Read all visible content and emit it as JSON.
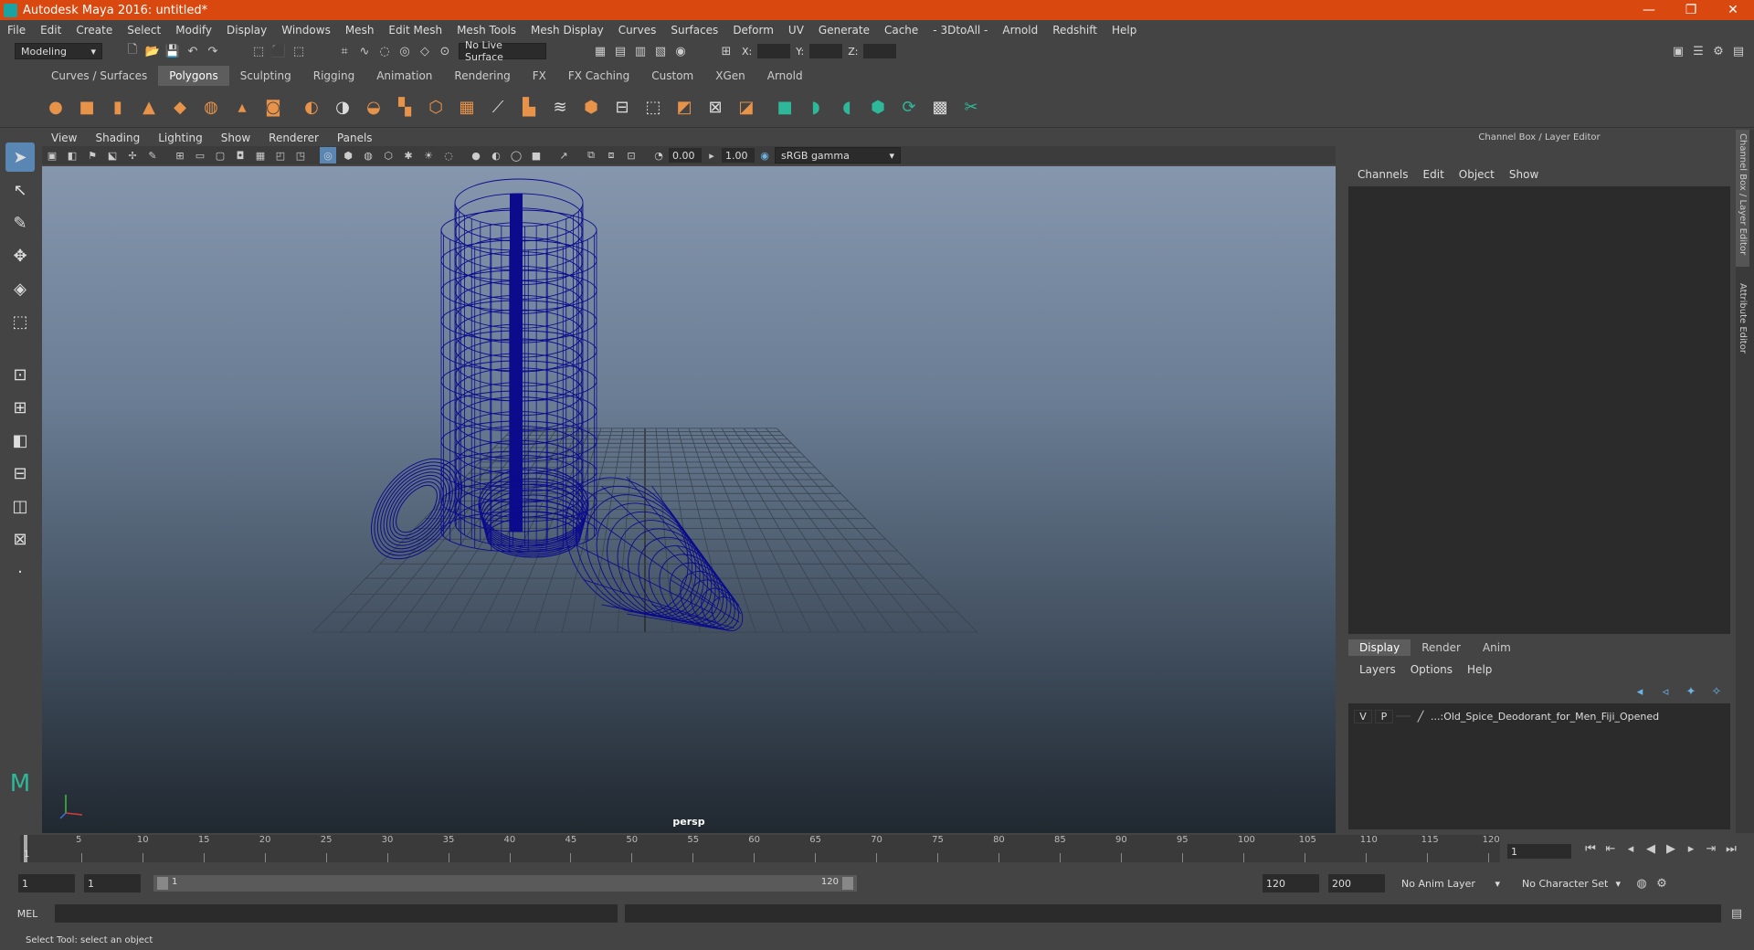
{
  "window": {
    "title": "Autodesk Maya 2016: untitled*",
    "min": "—",
    "max": "❐",
    "close": "✕"
  },
  "menubar": [
    "File",
    "Edit",
    "Create",
    "Select",
    "Modify",
    "Display",
    "Windows",
    "Mesh",
    "Edit Mesh",
    "Mesh Tools",
    "Mesh Display",
    "Curves",
    "Surfaces",
    "Deform",
    "UV",
    "Generate",
    "Cache",
    "- 3DtoAll -",
    "Arnold",
    "Redshift",
    "Help"
  ],
  "status": {
    "mode": "Modeling",
    "live_surface": "No Live Surface",
    "x_label": "X:",
    "y_label": "Y:",
    "z_label": "Z:"
  },
  "shelf_tabs": [
    "Curves / Surfaces",
    "Polygons",
    "Sculpting",
    "Rigging",
    "Animation",
    "Rendering",
    "FX",
    "FX Caching",
    "Custom",
    "XGen",
    "Arnold"
  ],
  "viewport": {
    "menu": [
      "View",
      "Shading",
      "Lighting",
      "Show",
      "Renderer",
      "Panels"
    ],
    "exposure": "0.00",
    "gamma": "1.00",
    "color_space": "sRGB gamma",
    "camera_label": "persp",
    "wire_color": "#0b0b8c"
  },
  "channel_box": {
    "title": "Channel Box / Layer Editor",
    "menu": [
      "Channels",
      "Edit",
      "Object",
      "Show"
    ],
    "tabs": [
      "Display",
      "Render",
      "Anim"
    ],
    "layer_menu": [
      "Layers",
      "Options",
      "Help"
    ],
    "layer": {
      "v": "V",
      "p": "P",
      "name": "...:Old_Spice_Deodorant_for_Men_Fiji_Opened"
    }
  },
  "side_tabs": [
    "Channel Box / Layer Editor",
    "Attribute Editor"
  ],
  "timeline": {
    "ticks": [
      "5",
      "10",
      "15",
      "20",
      "25",
      "30",
      "35",
      "40",
      "45",
      "50",
      "55",
      "60",
      "65",
      "70",
      "75",
      "80",
      "85",
      "90",
      "95",
      "100",
      "105",
      "110",
      "115",
      "120"
    ],
    "start_marker": "1",
    "current_frame": "1"
  },
  "range": {
    "start": "1",
    "playback_start": "1",
    "slider_start": "1",
    "slider_end": "120",
    "playback_end": "120",
    "end": "200",
    "anim_layer": "No Anim Layer",
    "char_set": "No Character Set"
  },
  "command": {
    "lang": "MEL"
  },
  "help_line": "Select Tool: select an object"
}
